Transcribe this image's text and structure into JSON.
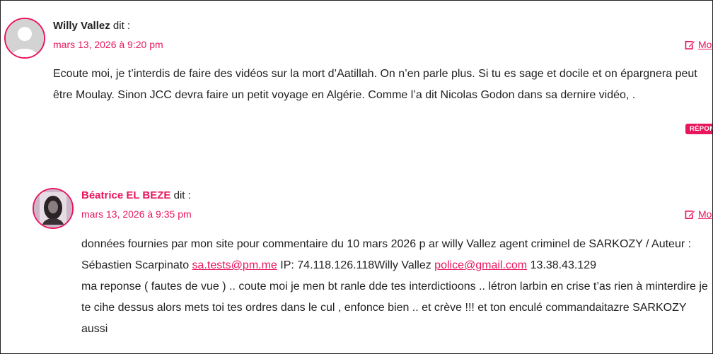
{
  "comments": [
    {
      "author": "Willy Vallez",
      "says": " dit :",
      "date": "mars 13, 2026 à 9:20 pm",
      "edit_label": "Mo",
      "text": "Ecoute moi, je t’interdis de faire des vidéos sur la mort d’Aatillah. On n’en parle plus. Si tu es sage et docile et on épargnera peut être Moulay. Sinon JCC devra faire un petit voyage en Algérie. Comme l’a dit Nicolas Godon dans sa dernire vidéo, .",
      "reply_label": "RÉPON"
    },
    {
      "author": "Béatrice EL BEZE",
      "says": " dit :",
      "date": "mars 13, 2026 à 9:35 pm",
      "edit_label": "Mo",
      "text_part1": "données fournies par mon site pour commentaire du 10 mars 2026 p ar willy Vallez agent criminel de SARKOZY / Auteur : Sébastien Scarpinato ",
      "email1": "sa.tests@pm.me",
      "text_part2": " IP: 74.118.126.118Willy Vallez ",
      "email2": "police@gmail.com",
      "text_part3": " 13.38.43.129",
      "text_part4": "ma reponse ( fautes de vue ) .. coute moi je men bt ranle dde tes interdictioons .. létron larbin en crise t’as rien à minterdire je te cihe dessus alors mets toi tes ordres dans le cul , enfonce bien .. et crève !!! et ton enculé commandaitazre SARKOZY aussi"
    }
  ],
  "colors": {
    "accent": "#e8175d",
    "text": "#222222"
  }
}
